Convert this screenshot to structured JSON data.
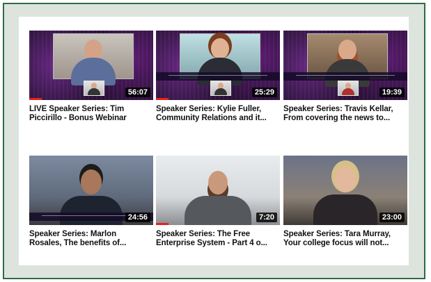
{
  "videos": [
    {
      "title_line1": "LIVE Speaker Series: Tim",
      "title_line2": "Piccirillo - Bonus Webinar",
      "duration": "56:07",
      "progress": 0.1
    },
    {
      "title_line1": "Speaker Series: Kylie Fuller,",
      "title_line2": "Community Relations and it...",
      "duration": "25:29",
      "progress": 0.1
    },
    {
      "title_line1": "Speaker Series: Travis Kellar,",
      "title_line2": "From covering the news to...",
      "duration": "19:39",
      "progress": 0.0
    },
    {
      "title_line1": "Speaker Series: Marlon",
      "title_line2": "Rosales, The benefits of...",
      "duration": "24:56",
      "progress": 0.0
    },
    {
      "title_line1": "Speaker Series: The Free",
      "title_line2": "Enterprise System - Part 4 o...",
      "duration": "7:20",
      "progress": 0.1
    },
    {
      "title_line1": "Speaker Series: Tara Murray,",
      "title_line2": "Your college focus will not...",
      "duration": "23:00",
      "progress": 0.0
    }
  ],
  "colors": {
    "frame_border": "#2e6b45",
    "frame_bg": "#dde4de",
    "progress": "#e1231b"
  }
}
